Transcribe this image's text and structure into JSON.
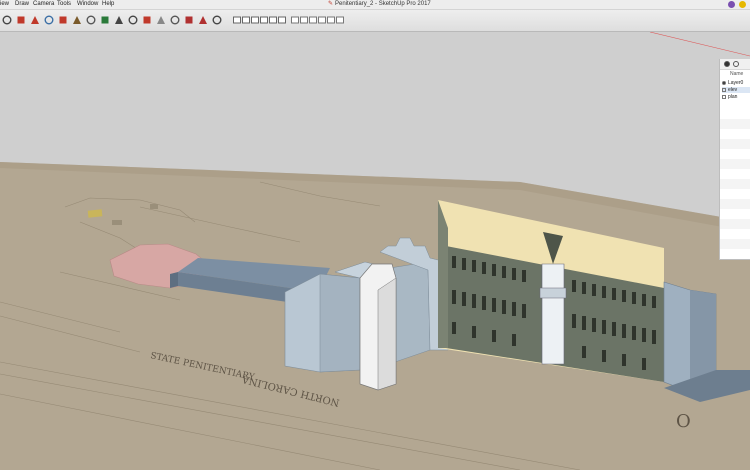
{
  "menu": {
    "items": [
      "View",
      "Draw",
      "Camera",
      "Tools",
      "Window",
      "Help"
    ],
    "items_display": [
      "iew",
      "Draw",
      "Camera",
      "Tools",
      "Window",
      "Help"
    ]
  },
  "window": {
    "title": "Penitentiary_2 - SketchUp Pro 2017"
  },
  "toolbar": {
    "tools": [
      "move-icon",
      "rotate-icon",
      "scale-icon",
      "push-pull-icon",
      "follow-me-icon",
      "offset-icon",
      "tape-measure-icon",
      "protractor-icon",
      "dimension-icon",
      "text-icon",
      "axes-icon",
      "section-plane-icon",
      "zoom-extents-icon",
      "3d-warehouse-icon",
      "extension-warehouse-icon",
      "components-icon",
      "iso-view-icon",
      "top-view-icon",
      "front-view-icon",
      "right-view-icon",
      "back-view-icon",
      "left-view-icon",
      "xray-icon",
      "wireframe-icon",
      "hidden-line-icon",
      "shaded-icon",
      "textured-icon",
      "monochrome-icon"
    ]
  },
  "layers_panel": {
    "column_header": "Name",
    "layers": [
      {
        "name": "Layer0",
        "active": true
      },
      {
        "name": "elev",
        "active": false
      },
      {
        "name": "plan",
        "active": false
      }
    ]
  },
  "map_text": {
    "line1": "STATE PENITENTIARY",
    "line2": "NORTH CAROLINA",
    "corner_letter": "O"
  },
  "colors": {
    "sky": "#cfcfcf",
    "ground": "#b3a792",
    "building": "#b9c7d3",
    "tower": "#f2f2f2",
    "photo": "#f0e2b2",
    "pink_plan": "#d7a7a4"
  }
}
